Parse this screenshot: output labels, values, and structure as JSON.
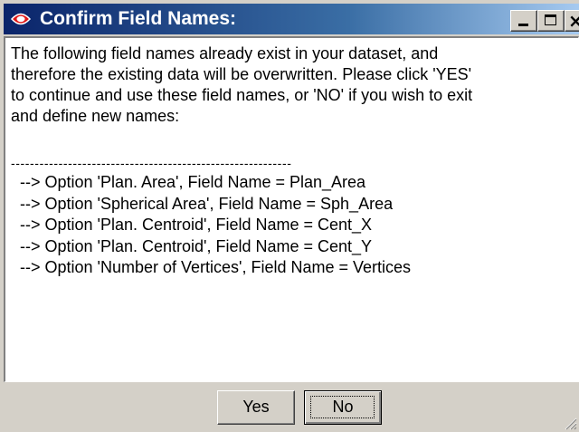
{
  "window": {
    "title": "Confirm Field Names:",
    "icon": "red-eye-icon"
  },
  "titlebar_buttons": {
    "minimize": "minimize-icon",
    "maximize": "maximize-icon",
    "close": "close-icon"
  },
  "message": {
    "line1": "The following field names already exist in your dataset, and",
    "line2": "therefore the existing data will be overwritten. Please click 'YES'",
    "line3": "to continue and use these field names, or 'NO' if you wish to exit",
    "line4": "and define new names:",
    "separator": "-----------------------------------------------------------"
  },
  "options": [
    "--> Option 'Plan. Area',  Field Name = Plan_Area",
    "--> Option 'Spherical Area',  Field Name = Sph_Area",
    "--> Option 'Plan. Centroid',  Field Name = Cent_X",
    "--> Option 'Plan. Centroid',  Field Name = Cent_Y",
    "--> Option 'Number of Vertices',  Field Name = Vertices"
  ],
  "buttons": {
    "yes": "Yes",
    "no": "No"
  },
  "colors": {
    "titlebar_start": "#0a246a",
    "titlebar_end": "#a6caf0",
    "face": "#d4d0c8",
    "icon_red": "#e01818"
  }
}
